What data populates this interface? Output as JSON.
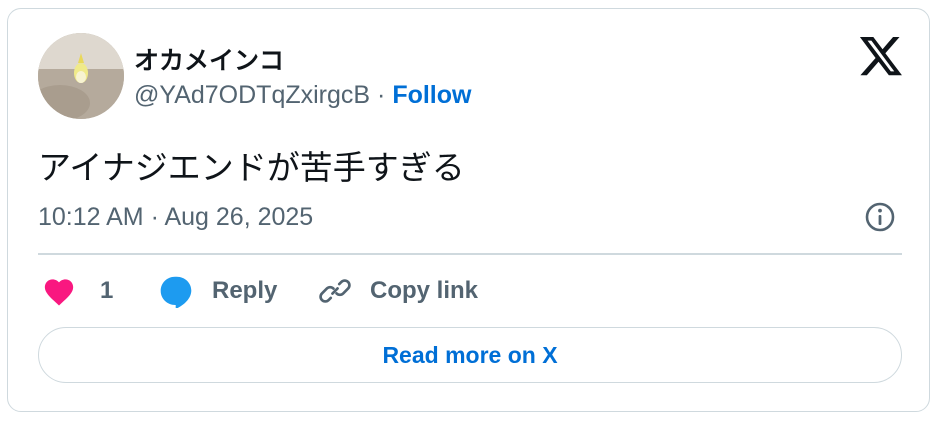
{
  "author": {
    "name": "オカメインコ",
    "handle": "@YAd7ODTqZxirgcB",
    "separator": " · ",
    "follow_label": "Follow"
  },
  "tweet": {
    "text": "アイナジエンドが苦手すぎる",
    "timestamp": "10:12 AM · Aug 26, 2025"
  },
  "actions": {
    "like_count": "1",
    "reply_label": "Reply",
    "copy_link_label": "Copy link"
  },
  "read_more_label": "Read more on X",
  "icons": {
    "logo": "x-logo-icon",
    "info": "info-icon",
    "like": "heart-icon",
    "reply": "speech-bubble-icon",
    "copy": "link-icon"
  },
  "colors": {
    "accent": "#006fd6",
    "like": "#f91880",
    "reply": "#1d9bf0",
    "text": "#0f1419",
    "secondary": "#536471",
    "border": "#cfd9de"
  }
}
